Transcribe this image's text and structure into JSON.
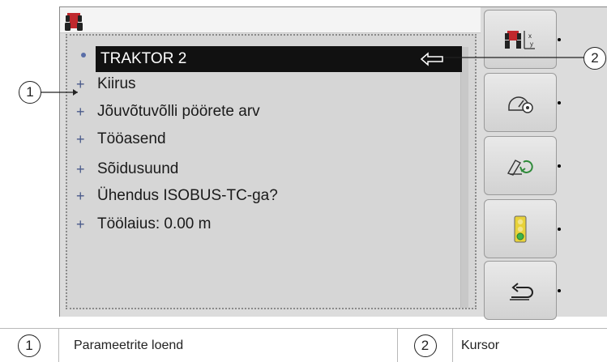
{
  "list": {
    "items": [
      {
        "mark": "",
        "label": "TRAKTOR 2",
        "selected": true
      },
      {
        "mark": "+",
        "label": "Kiirus"
      },
      {
        "mark": "+",
        "label": "Jõuvõtuvõlli pöörete arv"
      },
      {
        "mark": "+",
        "label": "Tööasend"
      },
      {
        "mark": "+",
        "label": "Sõidusuund"
      },
      {
        "mark": "+",
        "label": "Ühendus ISOBUS-TC-ga?"
      },
      {
        "mark": "+",
        "label": "Töölaius: 0.00 m"
      }
    ]
  },
  "softkeys": [
    {
      "icon": "tractor-xy-icon",
      "axis_x": "x",
      "axis_y": "y"
    },
    {
      "icon": "speed-sensor-icon"
    },
    {
      "icon": "pto-rotation-icon"
    },
    {
      "icon": "traffic-light-icon"
    },
    {
      "icon": "back-return-icon"
    }
  ],
  "callouts": {
    "one": "1",
    "two": "2"
  },
  "legend": {
    "n1": "1",
    "t1": "Parameetrite loend",
    "n2": "2",
    "t2": "Kursor"
  },
  "colors": {
    "selection": "#111111",
    "tractor": "#c0282d",
    "bullet": "#5a6ea8",
    "traffic_green": "#3cb54a",
    "traffic_yellow": "#e8d23a"
  }
}
